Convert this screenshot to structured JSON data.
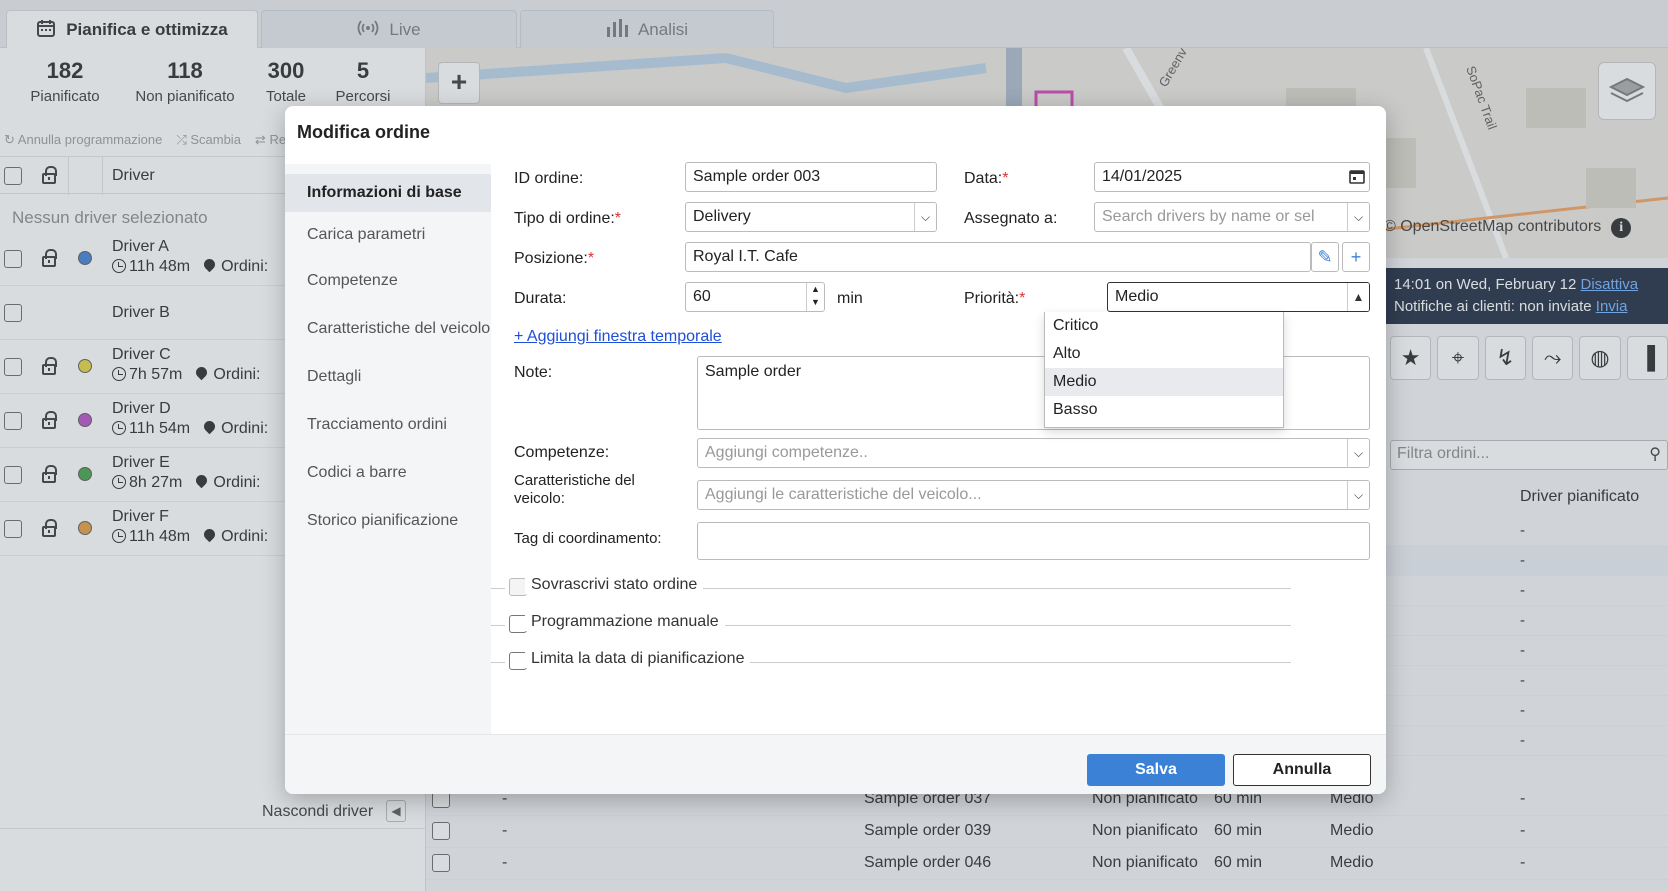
{
  "tabs": [
    {
      "label": "Pianifica e ottimizza",
      "icon": "calendar-icon"
    },
    {
      "label": "Live",
      "icon": "broadcast-icon"
    },
    {
      "label": "Analisi",
      "icon": "bar-chart-icon"
    }
  ],
  "stats": [
    {
      "value": "182",
      "label": "Pianificato"
    },
    {
      "value": "118",
      "label": "Non pianificato"
    },
    {
      "value": "300",
      "label": "Totale"
    },
    {
      "value": "5",
      "label": "Percorsi"
    }
  ],
  "toolbar": {
    "undo": "Annulla programmazione",
    "swap": "Scambia",
    "re": "Re"
  },
  "driver_table": {
    "header": "Driver",
    "empty_text": "Nessun driver selezionato",
    "drivers": [
      {
        "name": "Driver A",
        "time": "11h 48m",
        "orders": "Ordini:",
        "color": "#3a7bd5",
        "locked": true
      },
      {
        "name": "Driver B",
        "time": "",
        "orders": "",
        "color": "",
        "locked": false
      },
      {
        "name": "Driver C",
        "time": "7h 57m",
        "orders": "Ordini:",
        "color": "#e3d638",
        "locked": true
      },
      {
        "name": "Driver D",
        "time": "11h 54m",
        "orders": "Ordini:",
        "color": "#b548c6",
        "locked": true
      },
      {
        "name": "Driver E",
        "time": "8h 27m",
        "orders": "Ordini:",
        "color": "#3f9e3f",
        "locked": true
      },
      {
        "name": "Driver F",
        "time": "11h 48m",
        "orders": "Ordini:",
        "color": "#e39a38",
        "locked": true
      }
    ],
    "hide_label": "Nascondi driver"
  },
  "map": {
    "street_1": "Greenv",
    "street_2": "SoPac Trail",
    "attribution": "© OpenStreetMap contributors"
  },
  "notice": {
    "line1": "14:01 on Wed, February 12",
    "deactivate": "Disattiva",
    "line2": "Notifiche ai clienti: non inviate",
    "send": "Invia"
  },
  "orders_panel": {
    "filter_placeholder": "Filtra ordini...",
    "column_driver": "Driver pianificato",
    "rows": [
      "-",
      "-",
      "-",
      "-",
      "-",
      "-",
      "-",
      "-"
    ]
  },
  "bottom_rows": [
    {
      "dash": "-",
      "name": "Sample order 037",
      "status": "Non pianificato",
      "duration": "60 min",
      "priority": "Medio",
      "driver": "-"
    },
    {
      "dash": "-",
      "name": "Sample order 039",
      "status": "Non pianificato",
      "duration": "60 min",
      "priority": "Medio",
      "driver": "-"
    },
    {
      "dash": "-",
      "name": "Sample order 046",
      "status": "Non pianificato",
      "duration": "60 min",
      "priority": "Medio",
      "driver": "-"
    }
  ],
  "modal": {
    "title": "Modifica ordine",
    "sections": [
      "Informazioni di base",
      "Carica parametri",
      "Competenze",
      "Caratteristiche del veicolo",
      "Dettagli",
      "Tracciamento ordini",
      "Codici a barre",
      "Storico pianificazione"
    ],
    "fields": {
      "order_id_label": "ID ordine:",
      "order_id": "Sample order 003",
      "date_label": "Data:",
      "date": "14/01/2025",
      "type_label": "Tipo di ordine:",
      "type": "Delivery",
      "assigned_label": "Assegnato a:",
      "assigned_placeholder": "Search drivers by name or sel",
      "position_label": "Posizione:",
      "position": "Royal I.T. Cafe",
      "duration_label": "Durata:",
      "duration": "60",
      "duration_unit": "min",
      "priority_label": "Priorità:",
      "priority": "Medio",
      "add_window": "+ Aggiungi finestra temporale",
      "notes_label": "Note:",
      "notes": "Sample order",
      "skills_label": "Competenze:",
      "skills_placeholder": "Aggiungi competenze..",
      "vehicle_label_1": "Caratteristiche del",
      "vehicle_label_2": "veicolo:",
      "vehicle_placeholder": "Aggiungi le caratteristiche del veicolo...",
      "tag_label": "Tag di coordinamento:",
      "tag": ""
    },
    "checkboxes": [
      "Sovrascrivi stato ordine",
      "Programmazione manuale",
      "Limita la data di pianificazione"
    ],
    "priority_options": [
      "Critico",
      "Alto",
      "Medio",
      "Basso"
    ],
    "save": "Salva",
    "cancel": "Annulla"
  },
  "colors": {
    "accent": "#3b82d6",
    "link": "#1d4fd8",
    "required": "#d33333",
    "notice_bg": "#15233a"
  }
}
